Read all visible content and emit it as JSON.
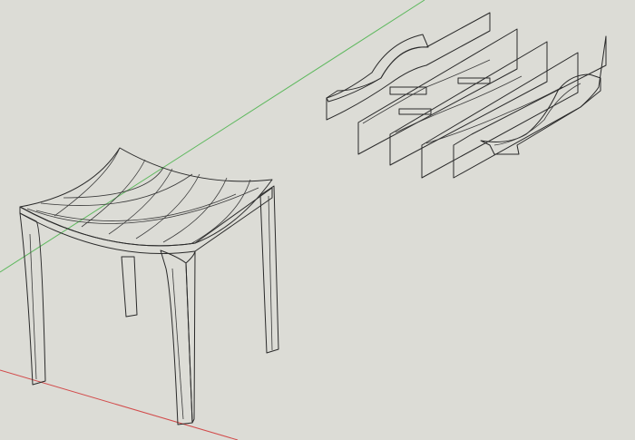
{
  "viewport": {
    "background_color": "#dcdcd6"
  },
  "axes": {
    "green_axis_color": "#5db85d",
    "red_axis_color": "#d24b4b"
  },
  "models": {
    "stool": {
      "face_color": "#f4f4f4",
      "shade_color": "#bdbdbd",
      "edge_color": "#2a2a2a"
    },
    "slats": {
      "face_color": "#c9c9c9",
      "edge_color": "#2a2a2a"
    }
  }
}
